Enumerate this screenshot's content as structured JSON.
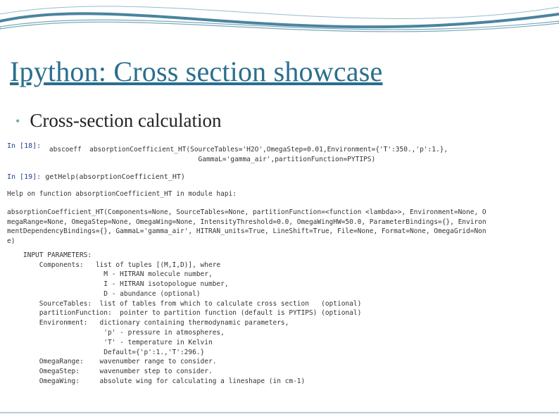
{
  "title": "Ipython: Cross section showcase",
  "subtitle": "Cross-section calculation",
  "cells": {
    "in18_prompt": "In [18]:",
    "in18_code": " abscoeff  absorptionCoefficient_HT(SourceTables='H2O',OmegaStep=0.01,Environment={'T':350.,'p':1.},\n                                      GammaL='gamma_air',partitionFunction=PYTIPS)",
    "in19_prompt": "In [19]:",
    "in19_code": " getHelp(absorptionCoefficient_HT)",
    "help_header": "Help on function absorptionCoefficient_HT in module hapi:",
    "help_sig": "absorptionCoefficient_HT(Components=None, SourceTables=None, partitionFunction=<function <lambda>>, Environment=None, O\nmegaRange=None, OmegaStep=None, OmegaWing=None, IntensityThreshold=0.0, OmegaWingHW=50.0, ParameterBindings={}, Environ\nmentDependencyBindings={}, GammaL='gamma_air', HITRAN_units=True, LineShift=True, File=None, Format=None, OmegaGrid=Non\ne)",
    "help_body": "    INPUT PARAMETERS:\n        Components:   list of tuples [(M,I,D)], where\n                        M - HITRAN molecule number,\n                        I - HITRAN isotopologue number,\n                        D - abundance (optional)\n        SourceTables:  list of tables from which to calculate cross section   (optional)\n        partitionFunction:  pointer to partition function (default is PYTIPS) (optional)\n        Environment:   dictionary containing thermodynamic parameters,\n                        'p' - pressure in atmospheres,\n                        'T' - temperature in Kelvin\n                        Default={'p':1.,'T':296.}\n        OmegaRange:    wavenumber range to consider.\n        OmegaStep:     wavenumber step to consider.\n        OmegaWing:     absolute wing for calculating a lineshape (in cm-1)"
  }
}
